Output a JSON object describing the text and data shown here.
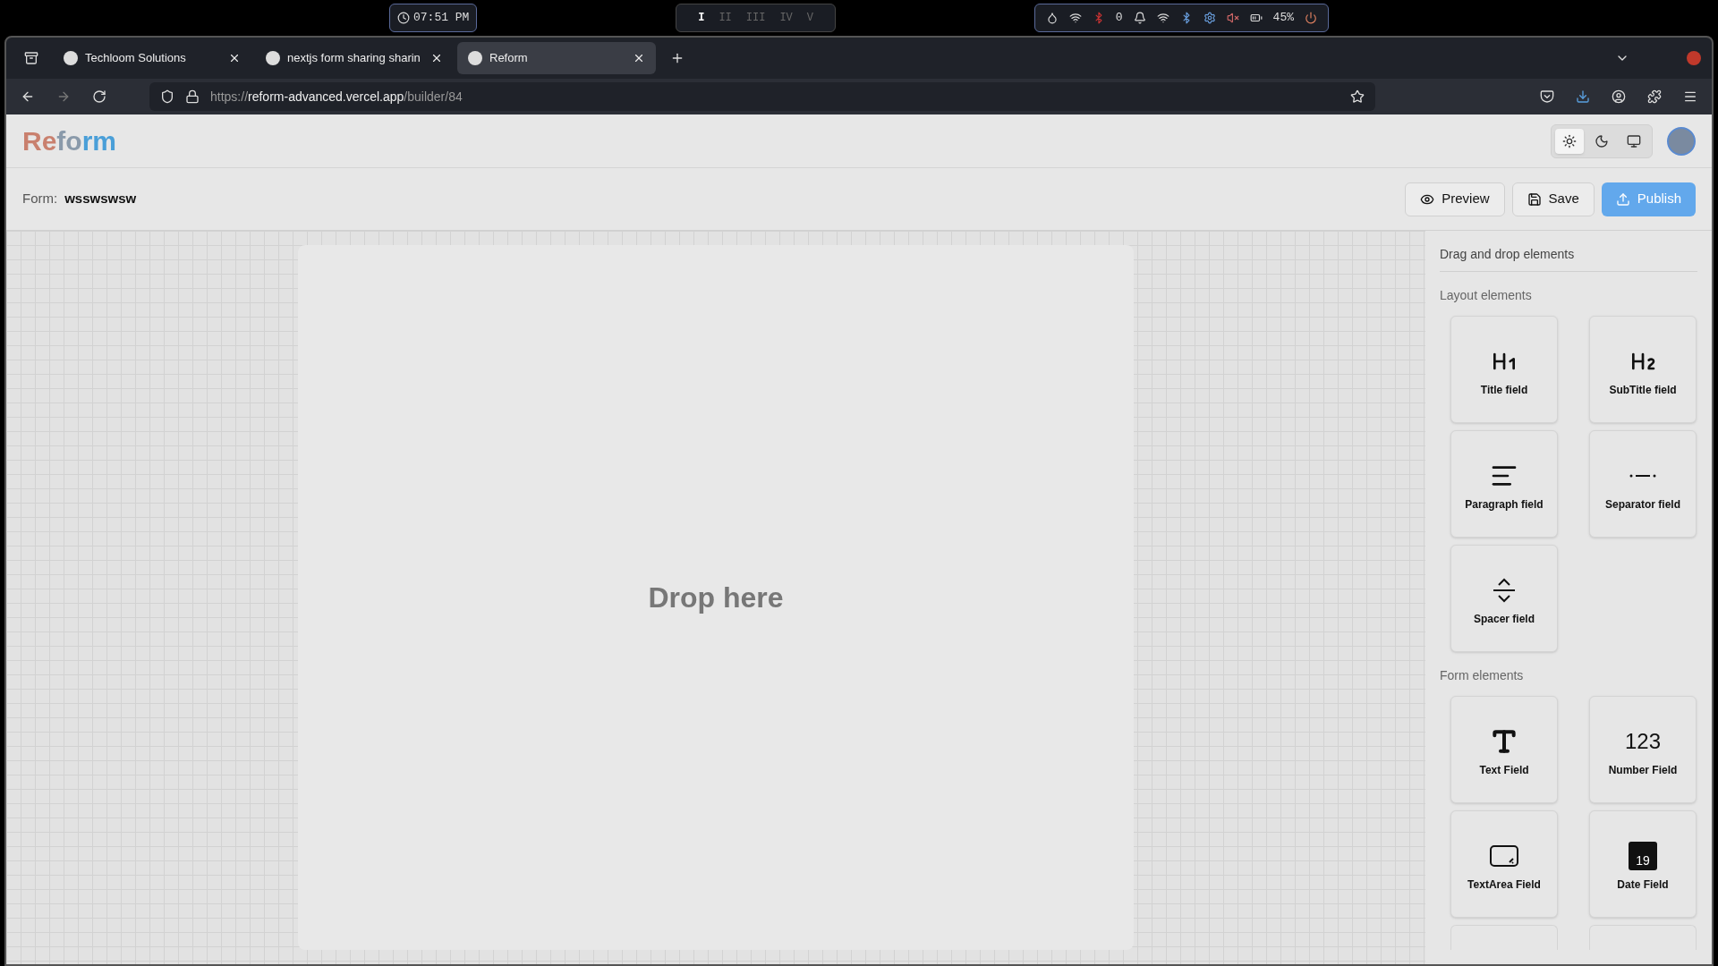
{
  "system_bar": {
    "clock": "07:51 PM",
    "workspaces": [
      {
        "label": "I",
        "selected": true
      },
      {
        "label": "II",
        "selected": false
      },
      {
        "label": "III",
        "selected": false
      },
      {
        "label": "IV",
        "selected": false
      },
      {
        "label": "V",
        "selected": false
      }
    ],
    "notifications": "0",
    "battery": "45%"
  },
  "browser": {
    "tabs": [
      {
        "title": "Techloom Solutions",
        "selected": false
      },
      {
        "title": "nextjs form sharing sharin",
        "selected": false
      },
      {
        "title": "Reform",
        "selected": true
      }
    ],
    "url": {
      "scheme": "https://",
      "host": "reform-advanced.vercel.app",
      "path": "/builder/84"
    }
  },
  "app": {
    "logo": {
      "part_1": "Re",
      "part_2": "fo",
      "part_3": "rm"
    },
    "theme_modes": [
      {
        "kind": "light",
        "selected": true
      },
      {
        "kind": "dark",
        "selected": false
      },
      {
        "kind": "system",
        "selected": false
      }
    ]
  },
  "form_bar": {
    "label": "Form:",
    "name": "wsswswsw",
    "buttons": [
      {
        "kind": "preview",
        "label": "Preview"
      },
      {
        "kind": "save",
        "label": "Save"
      },
      {
        "kind": "publish",
        "label": "Publish"
      }
    ]
  },
  "canvas": {
    "drop_text": "Drop here"
  },
  "sidebar": {
    "title": "Drag and drop elements",
    "sections": [
      {
        "title": "Layout elements",
        "items": [
          {
            "kind": "title",
            "label": "Title field"
          },
          {
            "kind": "subtitle",
            "label": "SubTitle field"
          },
          {
            "kind": "paragraph",
            "label": "Paragraph field"
          },
          {
            "kind": "separator",
            "label": "Separator field"
          },
          {
            "kind": "spacer",
            "label": "Spacer field"
          }
        ]
      },
      {
        "title": "Form elements",
        "items": [
          {
            "kind": "text",
            "label": "Text Field"
          },
          {
            "kind": "number",
            "label": "Number Field",
            "icon_text": "123"
          },
          {
            "kind": "textarea",
            "label": "TextArea Field"
          },
          {
            "kind": "date",
            "label": "Date Field",
            "icon_text": "19"
          },
          {
            "kind": "cut"
          },
          {
            "kind": "cut"
          }
        ]
      }
    ]
  }
}
